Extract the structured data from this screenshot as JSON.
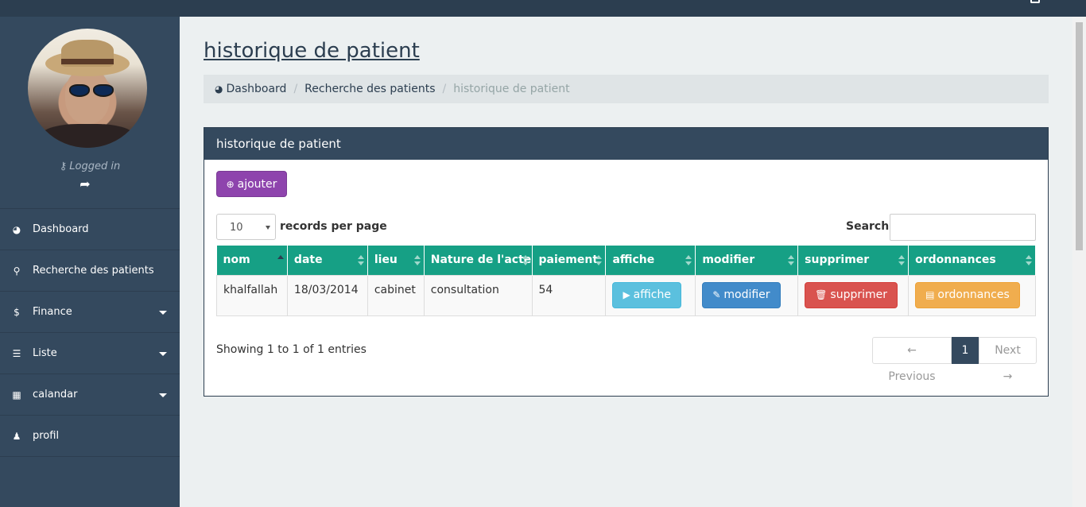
{
  "sidebar": {
    "logged_in": "Logged in",
    "menu": [
      {
        "label": "Dashboard",
        "icon": "dashboard-icon"
      },
      {
        "label": "Recherche des patients",
        "icon": "search-icon"
      },
      {
        "label": "Finance",
        "icon": "dollar-icon",
        "dropdown": true
      },
      {
        "label": "Liste",
        "icon": "list-icon",
        "dropdown": true
      },
      {
        "label": "calandar",
        "icon": "calendar-icon",
        "dropdown": true
      },
      {
        "label": "profil",
        "icon": "user-icon"
      }
    ]
  },
  "page": {
    "title": "historique de patient"
  },
  "breadcrumb": {
    "items": [
      "Dashboard",
      "Recherche des patients",
      "historique de patient"
    ]
  },
  "panel": {
    "heading": "historique de patient",
    "add_label": "ajouter",
    "length_value": "10",
    "length_label": "records per page",
    "search_label": "Search:",
    "search_value": ""
  },
  "table": {
    "columns": [
      "nom",
      "date",
      "lieu",
      "Nature de l'acte",
      "paiement",
      "affiche",
      "modifier",
      "supprimer",
      "ordonnances"
    ],
    "rows": [
      {
        "nom": "khalfallah",
        "date": "18/03/2014",
        "lieu": "cabinet",
        "nature": "consultation",
        "paiement": "54",
        "affiche": "affiche",
        "modifier": "modifier",
        "supprimer": "supprimer",
        "ordonnances": "ordonnances"
      }
    ]
  },
  "footer": {
    "info": "Showing 1 to 1 of 1 entries",
    "prev": "← Previous",
    "page": "1",
    "next": "Next →"
  },
  "colors": {
    "sidebar": "#34495e",
    "table_header": "#16a085",
    "add_button": "#8e44ad"
  }
}
